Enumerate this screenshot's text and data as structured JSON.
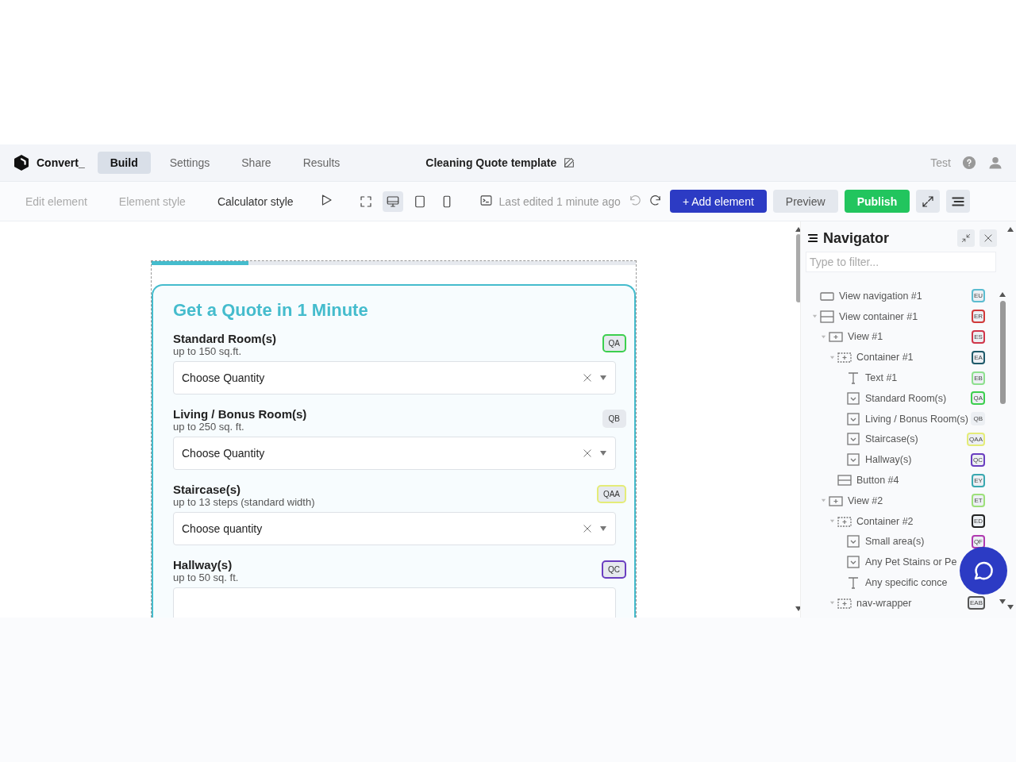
{
  "header": {
    "brand": "Convert_",
    "tabs": [
      {
        "label": "Build",
        "selected": true
      },
      {
        "label": "Settings",
        "selected": false
      },
      {
        "label": "Share",
        "selected": false
      },
      {
        "label": "Results",
        "selected": false
      }
    ],
    "doc_title": "Cleaning Quote template",
    "test_label": "Test"
  },
  "toolbar": {
    "modes": [
      {
        "label": "Edit element",
        "disabled": true
      },
      {
        "label": "Element style",
        "disabled": true
      },
      {
        "label": "Calculator style",
        "disabled": false
      }
    ],
    "devices": [
      {
        "kind": "fullscreen",
        "selected": false
      },
      {
        "kind": "desktop",
        "selected": true
      },
      {
        "kind": "tablet",
        "selected": false
      },
      {
        "kind": "phone",
        "selected": false
      }
    ],
    "last_edited": "Last edited 1 minute ago",
    "add_button": "+ Add element",
    "preview_button": "Preview",
    "publish_button": "Publish"
  },
  "form": {
    "progress": {
      "level": 0.2
    },
    "title": "Get a Quote in 1 Minute",
    "questions": [
      {
        "label": "Standard Room(s)",
        "hint": "up to 150 sq.ft.",
        "placeholder": "Choose Quantity",
        "tag": "QA",
        "color": "#3ccf4e"
      },
      {
        "label": "Living / Bonus Room(s)",
        "hint": "up to 250 sq. ft.",
        "placeholder": "Choose Quantity",
        "tag": "QB"
      },
      {
        "label": "Staircase(s)",
        "hint": "up to 13 steps (standard width)",
        "placeholder": "Choose quantity",
        "tag": "QAA",
        "color": "#e4ec78"
      },
      {
        "label": "Hallway(s)",
        "hint": "up to 50 sq. ft.",
        "tag": "QC",
        "color": "#6a3ec0"
      }
    ]
  },
  "navigator": {
    "title": "Navigator",
    "filter_placeholder": "Type to filter...",
    "tree": [
      {
        "label": "View navigation #1",
        "kind": "dots",
        "tag": "EU",
        "color": "#5bbcd0"
      },
      {
        "label": "View container #1",
        "kind": "rows",
        "tag": "ER",
        "color": "#d03a3a",
        "expanded": true,
        "children": [
          {
            "label": "View #1",
            "kind": "view",
            "tag": "ES",
            "color": "#d0364a",
            "expanded": true,
            "children": [
              {
                "label": "Container #1",
                "kind": "container",
                "tag": "EA",
                "color": "#1f5a6a",
                "expanded": true,
                "children": [
                  {
                    "label": "Text #1",
                    "kind": "text",
                    "tag": "EB",
                    "color": "#8ee08e"
                  },
                  {
                    "label": "Standard Room(s)",
                    "kind": "select",
                    "tag": "QA",
                    "color": "#3ccf4e"
                  },
                  {
                    "label": "Living / Bonus Room(s)",
                    "kind": "select",
                    "tag": "QB"
                  },
                  {
                    "label": "Staircase(s)",
                    "kind": "select",
                    "tag": "QAA",
                    "color": "#e4ec78"
                  },
                  {
                    "label": "Hallway(s)",
                    "kind": "select",
                    "tag": "QC",
                    "color": "#6a3ec0"
                  }
                ]
              },
              {
                "label": "Button #4",
                "kind": "button",
                "tag": "EY",
                "color": "#3aa8b0"
              }
            ]
          },
          {
            "label": "View #2",
            "kind": "view",
            "tag": "ET",
            "color": "#9ee07a",
            "expanded": true,
            "children": [
              {
                "label": "Container #2",
                "kind": "container",
                "tag": "ED",
                "color": "#222222",
                "expanded": true,
                "children": [
                  {
                    "label": "Small area(s)",
                    "kind": "select",
                    "tag": "QF",
                    "color": "#b03ab0"
                  },
                  {
                    "label": "Any Pet Stains or Pe",
                    "kind": "select"
                  },
                  {
                    "label": "Any specific conce",
                    "kind": "text"
                  }
                ]
              },
              {
                "label": "nav-wrapper",
                "kind": "container",
                "tag": "EAB",
                "color": "#555555",
                "expanded": true
              }
            ]
          }
        ]
      }
    ]
  }
}
